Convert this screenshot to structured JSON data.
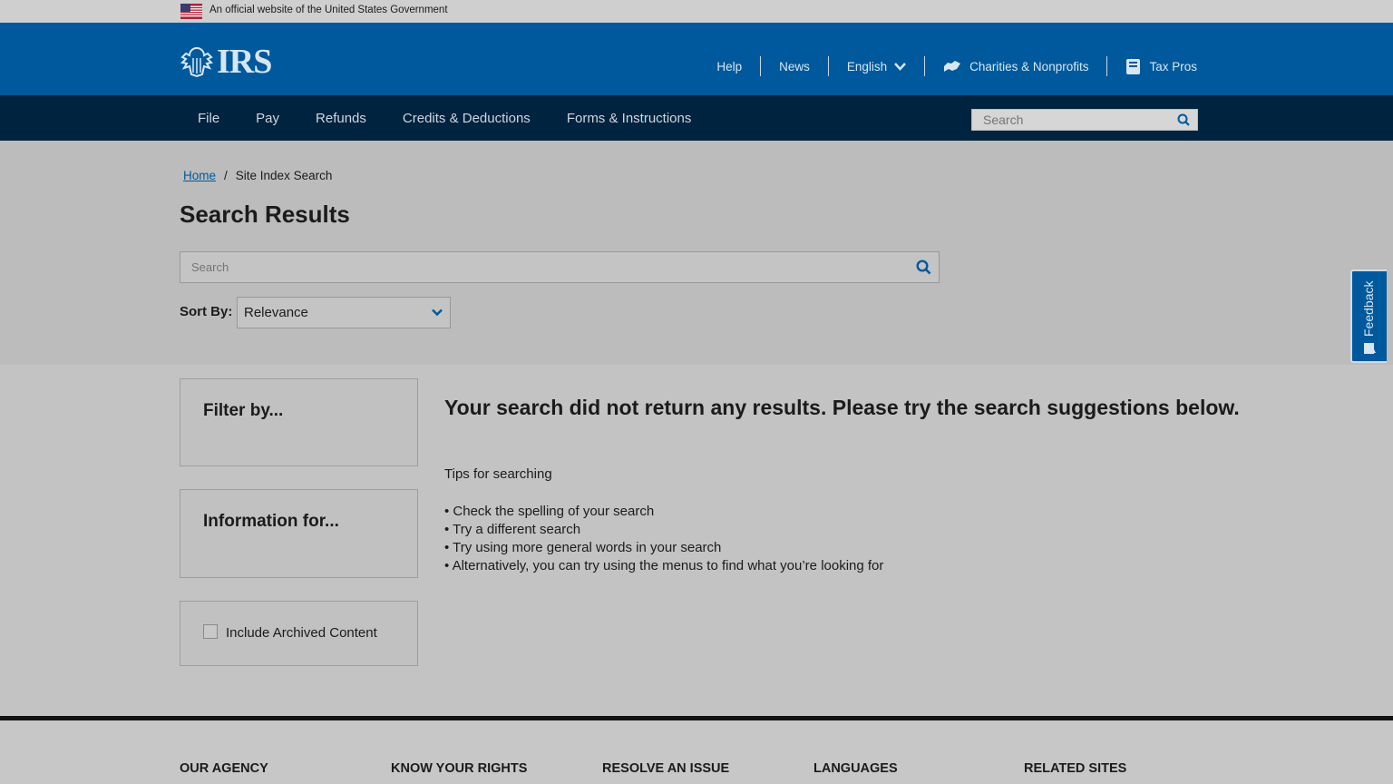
{
  "gov_banner": {
    "text": "An official website of the United States Government"
  },
  "header": {
    "logo": "IRS",
    "utility": [
      {
        "label": "Help",
        "icon": ""
      },
      {
        "label": "News",
        "icon": ""
      },
      {
        "label": "English",
        "icon": "chevron-down-icon"
      },
      {
        "label": "Charities & Nonprofits",
        "icon": "handshake-icon"
      },
      {
        "label": "Tax Pros",
        "icon": "book-icon"
      }
    ]
  },
  "nav": {
    "items": [
      "File",
      "Pay",
      "Refunds",
      "Credits & Deductions",
      "Forms & Instructions"
    ],
    "search_placeholder": "Search"
  },
  "breadcrumb": {
    "home": "Home",
    "separator": "/",
    "current": "Site Index Search"
  },
  "page_title": "Search Results",
  "search": {
    "placeholder": "Search"
  },
  "sort": {
    "label": "Sort By:",
    "selected": "Relevance"
  },
  "feedback": {
    "label": "Feedback"
  },
  "panels": {
    "filter_title": "Filter by...",
    "info_title": "Information for...",
    "archived_label": "Include Archived Content"
  },
  "results": {
    "no_results": "Your search did not return any results. Please try the search suggestions below.",
    "tips_title": "Tips for searching",
    "tips": [
      "• Check the spelling of your search",
      "• Try a different search",
      "• Try using more general words in your search",
      "• Alternatively, you can try using the menus to find what you’re looking for"
    ]
  },
  "footer": {
    "headings": [
      "OUR AGENCY",
      "KNOW YOUR RIGHTS",
      "RESOLVE AN ISSUE",
      "LANGUAGES",
      "RELATED SITES"
    ]
  },
  "colors": {
    "primary": "#00599c",
    "nav": "#00233f"
  }
}
